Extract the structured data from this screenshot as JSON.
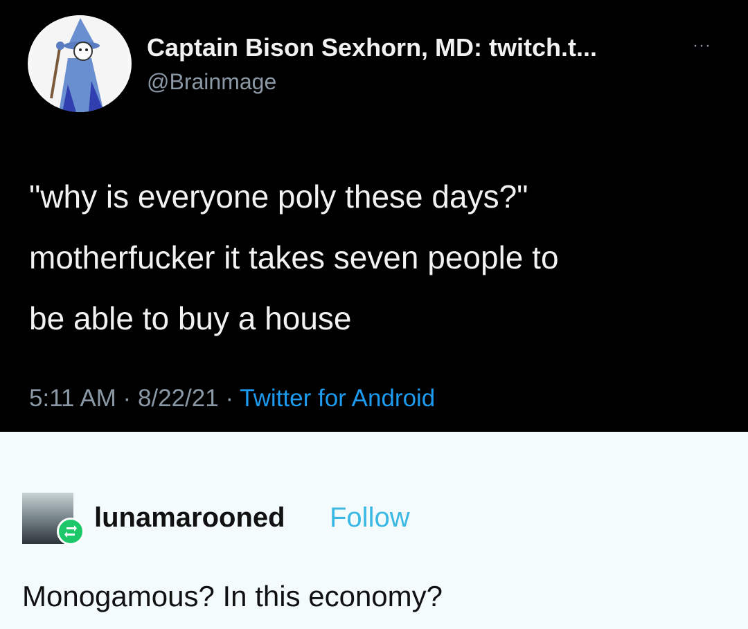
{
  "tweet": {
    "display_name": "Captain Bison Sexhorn, MD: twitch.t...",
    "handle": "@Brainmage",
    "more_label": "···",
    "text_lines": [
      "\"why is everyone poly these days?\"",
      "motherfucker it takes seven people to",
      "be able to buy a house"
    ],
    "time": "5:11 AM",
    "date": "8/22/21",
    "separator": " · ",
    "source": "Twitter for Android",
    "avatar_icon": "wizard-cartoon-avatar",
    "colors": {
      "background": "#000000",
      "text": "#f2f2f2",
      "secondary": "#8b98a5",
      "link": "#1d9bf0"
    }
  },
  "reblog": {
    "username": "lunamarooned",
    "follow_label": "Follow",
    "reply_text": "Monogamous? In this economy?",
    "avatar_icon": "photo-avatar",
    "badge_icon": "reblog-icon",
    "colors": {
      "background": "#f3fbfd",
      "text": "#111111",
      "follow": "#3bb8e3",
      "badge": "#1ec86a"
    }
  }
}
